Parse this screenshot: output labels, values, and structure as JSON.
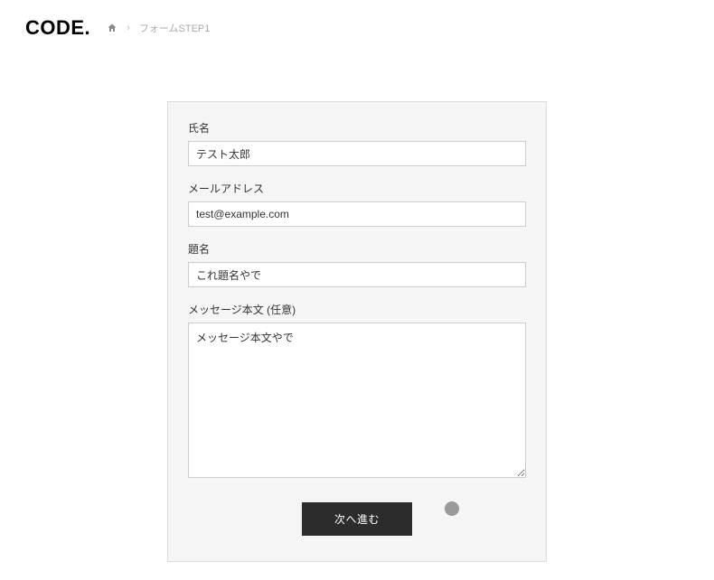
{
  "header": {
    "logo": "CODE.",
    "breadcrumb": {
      "current": "フォームSTEP1"
    }
  },
  "form": {
    "name": {
      "label": "氏名",
      "value": "テスト太郎"
    },
    "email": {
      "label": "メールアドレス",
      "value": "test@example.com"
    },
    "subject": {
      "label": "題名",
      "value": "これ題名やで"
    },
    "message": {
      "label": "メッセージ本文 (任意)",
      "value": "メッセージ本文やで"
    },
    "submit_label": "次へ進む"
  }
}
